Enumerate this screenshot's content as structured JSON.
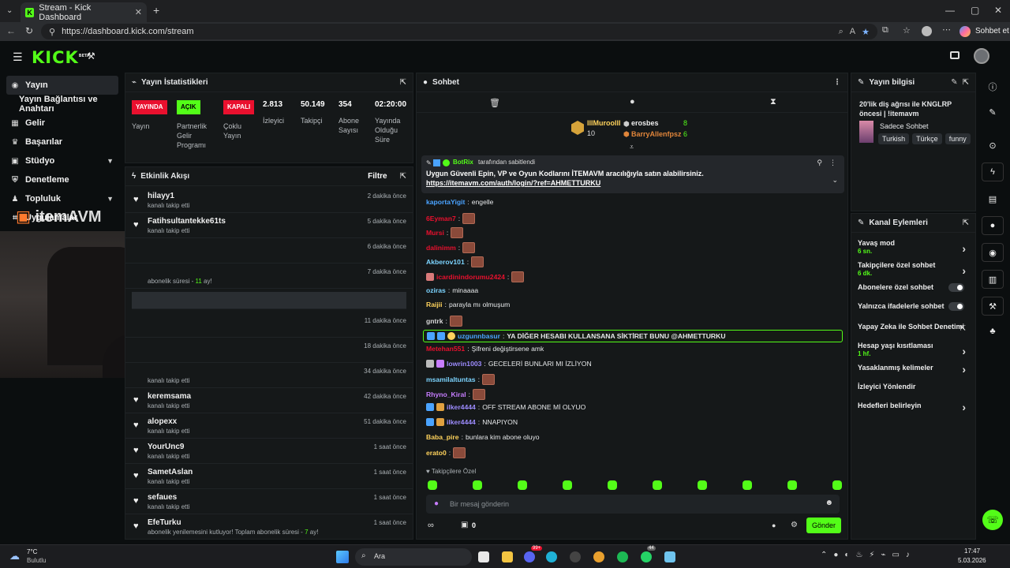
{
  "browser": {
    "tab_title": "Stream - Kick Dashboard",
    "url": "https://dashboard.kick.com/stream",
    "profile_label": "Sohbet et"
  },
  "header": {
    "logo": "KICK",
    "logo_beta": "BETA"
  },
  "sidebar": {
    "items": [
      {
        "label": "Yayın"
      },
      {
        "label": "Yayın Bağlantısı ve Anahtarı"
      },
      {
        "label": "Gelir"
      },
      {
        "label": "Başarılar"
      },
      {
        "label": "Stüdyo"
      },
      {
        "label": "Denetleme"
      },
      {
        "label": "Topluluk"
      },
      {
        "label": "Uygulamalar"
      }
    ],
    "overlay_logo": "itemAVM"
  },
  "stats": {
    "title": "Yayın İstatistikleri",
    "badges": [
      {
        "badge": "YAYINDA",
        "label": "Yayın"
      },
      {
        "badge": "AÇIK",
        "label": "Partnerlik Gelir Programı"
      },
      {
        "badge": "KAPALI",
        "label": "Çoklu Yayın"
      }
    ],
    "values": [
      {
        "value": "2.813",
        "label": "İzleyici"
      },
      {
        "value": "50.149",
        "label": "Takipçi"
      },
      {
        "value": "354",
        "label": "Abone Sayısı"
      },
      {
        "value": "02:20:00",
        "label": "Yayında Olduğu Süre"
      }
    ]
  },
  "activity": {
    "title": "Etkinlik Akışı",
    "filter": "Filtre",
    "items": [
      {
        "user": "hilayy1",
        "sub": "kanalı takip etti",
        "time": "2 dakika önce"
      },
      {
        "user": "Fatihsultantekke61ts",
        "sub": "kanalı takip etti",
        "time": "5 dakika önce"
      },
      {
        "user": "",
        "sub": "",
        "time": "6 dakika önce"
      },
      {
        "user": "",
        "sub": "abonelik süresi - 11 ay!",
        "time": "7 dakika önce"
      },
      {
        "user": "",
        "sub": "",
        "time": ""
      },
      {
        "user": "",
        "sub": "",
        "time": "11 dakika önce"
      },
      {
        "user": "",
        "sub": "",
        "time": "18 dakika önce"
      },
      {
        "user": "",
        "sub": "kanalı takip etti",
        "time": "34 dakika önce"
      },
      {
        "user": "keremsama",
        "sub": "kanalı takip etti",
        "time": "42 dakika önce"
      },
      {
        "user": "alopexx",
        "sub": "kanalı takip etti",
        "time": "51 dakika önce"
      },
      {
        "user": "YourUnc9",
        "sub": "kanalı takip etti",
        "time": "1 saat önce"
      },
      {
        "user": "SametAslan",
        "sub": "kanalı takip etti",
        "time": "1 saat önce"
      },
      {
        "user": "sefaues",
        "sub": "kanalı takip etti",
        "time": "1 saat önce"
      },
      {
        "user": "EfeTurku",
        "sub": "abonelik yenilemesini kutluyor! Toplam abonelik süresi - 7 ay!",
        "time": "1 saat önce"
      }
    ]
  },
  "chat": {
    "title": "Sohbet",
    "top_gifters": [
      {
        "name": "lllMuroolll",
        "count": "10"
      },
      {
        "name": "erosbes",
        "count": "8"
      },
      {
        "name": "BarryAllenfpsz",
        "count": "6"
      }
    ],
    "pinned": {
      "by": "BotRix",
      "by_suffix": "tarafından sabitlendi",
      "text": "Uygun Güvenli Epin, VP ve Oyun Kodlarını İTEMAVM aracılığıyla satın alabilirsiniz.",
      "link": "https://itemavm.com/auth/login/?ref=AHMETTURKU"
    },
    "messages": [
      {
        "user": "kaportaYigit",
        "color": "#4aa3ff",
        "text": "engelle"
      },
      {
        "user": "6Eyman7",
        "color": "#e9102e",
        "text": ""
      },
      {
        "user": "Mursi",
        "color": "#e9102e",
        "text": ""
      },
      {
        "user": "dalinimm",
        "color": "#e9102e",
        "text": ""
      },
      {
        "user": "Akberov101",
        "color": "#7cd4ff",
        "text": ""
      },
      {
        "user": "icardinindorumu2424",
        "color": "#e9102e",
        "text": ""
      },
      {
        "user": "oziras",
        "color": "#7cd4ff",
        "text": "minaaaa"
      },
      {
        "user": "Raijii",
        "color": "#ffd35c",
        "text": "parayla mı olmuşum"
      },
      {
        "user": "gntrk",
        "color": "#d9d9d9",
        "text": ""
      },
      {
        "user": "uzgunnbasur",
        "color": "#4aa3ff",
        "text": "YA DİĞER HESABI KULLANSANA SİKTİRET BUNU @AHMETTURKU"
      },
      {
        "user": "Metehan551",
        "color": "#e9102e",
        "text": "Şifreni değiştirsene amk"
      },
      {
        "user": "lowrin1003",
        "color": "#9d8cff",
        "text": "GECELERİ BUNLARI MI İZLİYON"
      },
      {
        "user": "msamilaltuntas",
        "color": "#7cd4ff",
        "text": ""
      },
      {
        "user": "Rhyno_Kiral",
        "color": "#c77dff",
        "text": ""
      },
      {
        "user": "ilker4444",
        "color": "#9d8cff",
        "text": "OFF STREAM ABONE Mİ OLYUO"
      },
      {
        "user": "ilker4444",
        "color": "#9d8cff",
        "text": "NNAPIYON"
      },
      {
        "user": "Baba_pire",
        "color": "#ffd35c",
        "text": "bunlara kim abone oluyo"
      },
      {
        "user": "erato0",
        "color": "#ffd35c",
        "text": ""
      }
    ],
    "followers_only": "Takipçilere Özel",
    "input_placeholder": "Bir mesaj gönderin",
    "points": "0",
    "send_label": "Gönder"
  },
  "stream_info": {
    "title": "Yayın bilgisi",
    "stream_title": "20'lik diş ağrısı ile KNGLRP öncesi | !itemavm",
    "category": "Sadece Sohbet",
    "tags": [
      "Turkish",
      "Türkçe",
      "funny"
    ]
  },
  "channel_actions": {
    "title": "Kanal Eylemleri",
    "items": [
      {
        "label": "Yavaş mod",
        "sub": "6 sn.",
        "control": "chevron"
      },
      {
        "label": "Takipçilere özel sohbet",
        "sub": "6 dk.",
        "control": "chevron"
      },
      {
        "label": "Abonelere özel sohbet",
        "sub": "",
        "control": "toggle"
      },
      {
        "label": "Yalnızca ifadelerle sohbet",
        "sub": "",
        "control": "toggle"
      },
      {
        "label": "Yapay Zeka ile Sohbet Denetimi",
        "sub": "",
        "control": "external"
      },
      {
        "label": "Hesap yaşı kısıtlaması",
        "sub": "1 hf.",
        "control": "chevron"
      },
      {
        "label": "Yasaklanmış kelimeler",
        "sub": "",
        "control": "chevron"
      },
      {
        "label": "İzleyici Yönlendir",
        "sub": "",
        "control": "none"
      },
      {
        "label": "Hedefleri belirleyin",
        "sub": "",
        "control": "chevron"
      }
    ]
  },
  "taskbar": {
    "weather_temp": "7°C",
    "weather_desc": "Bulutlu",
    "search": "Ara",
    "time": "17:47",
    "date": "5.03.2026",
    "badges": [
      "99+",
      "44"
    ]
  },
  "colors": {
    "accent": "#53fc18",
    "live_red": "#e9102e",
    "panel": "#151819",
    "bg": "#0b0e0f"
  }
}
